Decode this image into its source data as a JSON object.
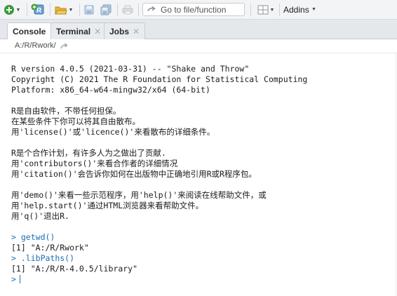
{
  "toolbar": {
    "goto_placeholder": "Go to file/function",
    "addins_label": "Addins"
  },
  "tabs": [
    {
      "label": "Console",
      "active": true
    },
    {
      "label": "Terminal",
      "closable": true
    },
    {
      "label": "Jobs",
      "closable": true
    }
  ],
  "path": "A:/R/Rwork/",
  "console": {
    "startup": [
      "R version 4.0.5 (2021-03-31) -- \"Shake and Throw\"",
      "Copyright (C) 2021 The R Foundation for Statistical Computing",
      "Platform: x86_64-w64-mingw32/x64 (64-bit)",
      "R是自由软件，不带任何担保。",
      "在某些条件下你可以将其自由散布。",
      "用'license()'或'licence()'来看散布的详细条件。",
      "R是个合作计划，有许多人为之做出了贡献.",
      "用'contributors()'来看合作者的详细情况",
      "用'citation()'会告诉你如何在出版物中正确地引用R或R程序包。",
      "用'demo()'来看一些示范程序，用'help()'来阅读在线帮助文件，或",
      "用'help.start()'通过HTML浏览器来看帮助文件。",
      "用'q()'退出R."
    ],
    "prompt": ">",
    "commands": [
      {
        "input": "getwd()",
        "output": "[1] \"A:/R/Rwork\""
      },
      {
        "input": ".libPaths()",
        "output": "[1] \"A:/R/R-4.0.5/library\""
      }
    ]
  },
  "colors": {
    "prompt": "#1b6fb6",
    "toolbar_bg": "#f3f4f6",
    "tabbar_bg": "#e4e7eb"
  },
  "icons": [
    "new-file-icon",
    "add-icon",
    "open-project-icon",
    "open-folder-icon",
    "save-icon",
    "save-all-icon",
    "print-icon",
    "goto-arrow-icon",
    "grid-layout-icon",
    "go-to-directory-icon"
  ]
}
